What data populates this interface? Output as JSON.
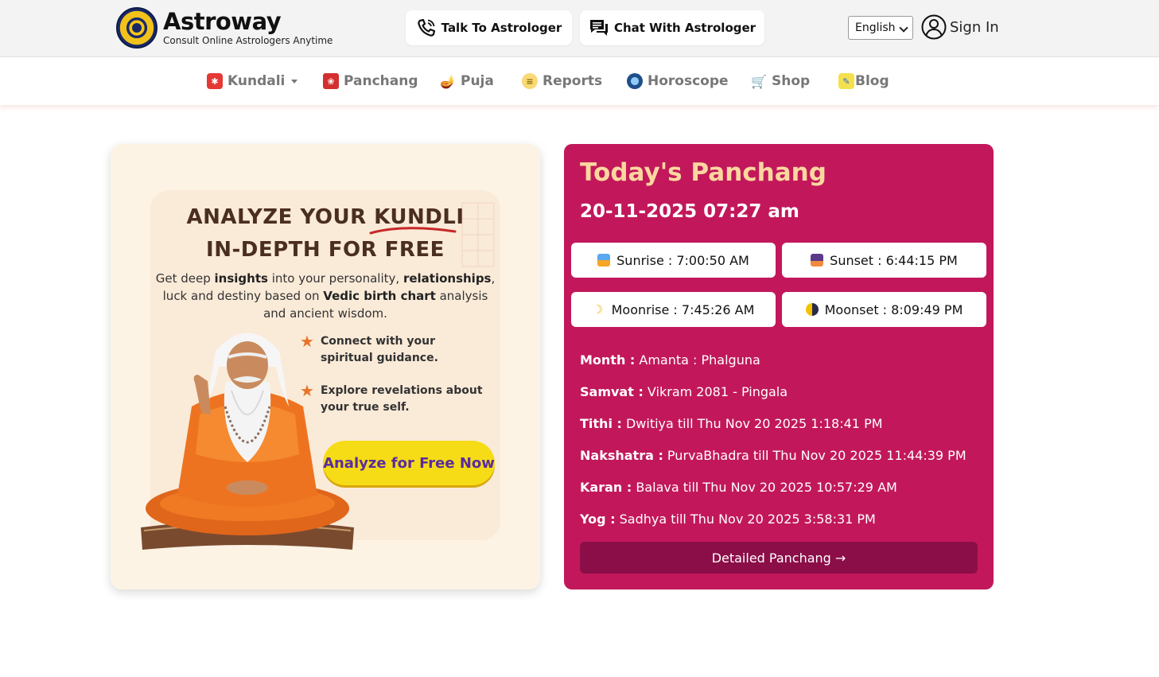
{
  "brand": {
    "name": "Astroway",
    "tagline": "Consult Online Astrologers Anytime"
  },
  "header": {
    "talk_label": "Talk To Astrologer",
    "chat_label": "Chat With Astrologer",
    "language": "English",
    "signin_label": "Sign In"
  },
  "nav": {
    "items": [
      {
        "label": "Kundali",
        "icon": "kundali-icon"
      },
      {
        "label": "Panchang",
        "icon": "panchang-icon"
      },
      {
        "label": "Puja",
        "icon": "puja-icon"
      },
      {
        "label": "Reports",
        "icon": "reports-icon"
      },
      {
        "label": "Horoscope",
        "icon": "horoscope-icon"
      },
      {
        "label": "Shop",
        "icon": "shop-icon"
      },
      {
        "label": "Blog",
        "icon": "blog-icon"
      }
    ]
  },
  "promo": {
    "title_line1": "ANALYZE YOUR KUNDLI",
    "title_line2": "IN-DEPTH FOR FREE",
    "desc_1": "Get deep ",
    "desc_b1": "insights",
    "desc_2": " into your personality, ",
    "desc_b2": "relationships",
    "desc_3": ", luck and destiny based on ",
    "desc_b3": "Vedic birth chart",
    "desc_4": " analysis and ancient wisdom.",
    "bullet_1": "Connect with your spiritual guidance.",
    "bullet_2": "Explore revelations about your true self.",
    "cta": "Analyze for Free Now"
  },
  "panchang": {
    "title": "Today's Panchang",
    "datetime": "20-11-2025 07:27 am",
    "sunrise": "Sunrise : 7:00:50 AM",
    "sunset": "Sunset : 6:44:15 PM",
    "moonrise": "Moonrise : 7:45:26 AM",
    "moonset": "Moonset : 8:09:49 PM",
    "rows": [
      {
        "label": "Month :",
        "value": " Amanta : Phalguna"
      },
      {
        "label": "Samvat :",
        "value": " Vikram 2081 - Pingala"
      },
      {
        "label": "Tithi :",
        "value": " Dwitiya till Thu Nov 20 2025 1:18:41 PM"
      },
      {
        "label": "Nakshatra :",
        "value": " PurvaBhadra till Thu Nov 20 2025 11:44:39 PM"
      },
      {
        "label": "Karan :",
        "value": " Balava till Thu Nov 20 2025 10:57:29 AM"
      },
      {
        "label": "Yog :",
        "value": " Sadhya till Thu Nov 20 2025 3:58:31 PM"
      }
    ],
    "detail_button": "Detailed Panchang →"
  },
  "colors": {
    "panchang_bg": "#c2185b",
    "panchang_title": "#fbd7a0",
    "detail_button_bg": "#8b0e48",
    "cta_bg": "#f6dc16",
    "cta_text": "#5a2ca0",
    "promo_bg": "#fdf3e5"
  }
}
